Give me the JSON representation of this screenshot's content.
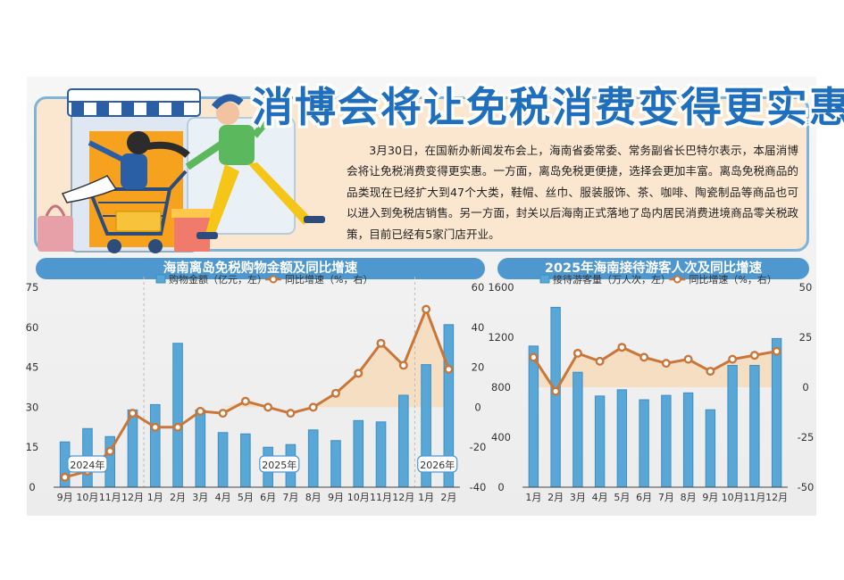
{
  "title": "消博会将让免税消费变得更实惠",
  "intro": "3月30日，在国新办新闻发布会上，海南省委常委、常务副省长巴特尔表示，本届消博会将让免税消费变得更实惠。一方面，离岛免税更便捷，选择会更加丰富。离岛免税商品的品类现在已经扩大到47个大类，鞋帽、丝巾、服装服饰、茶、咖啡、陶瓷制品等商品也可以进入到免税店销售。另一方面，封关以后海南正式落地了岛内居民消费进境商品零关税政策，目前已经有5家门店开业。",
  "colors": {
    "bar": "#58a7d6",
    "line": "#c8763a",
    "accent": "#1f6fbd",
    "header": "#4f97cf"
  },
  "chart_data": [
    {
      "type": "bar",
      "title": "海南离岛免税购物金额及同比增速",
      "categories": [
        "9月",
        "10月",
        "11月",
        "12月",
        "1月",
        "2月",
        "3月",
        "4月",
        "5月",
        "6月",
        "7月",
        "8月",
        "9月",
        "10月",
        "11月",
        "12月",
        "1月",
        "2月"
      ],
      "year_markers": [
        {
          "label": "2024年",
          "index": 1
        },
        {
          "label": "2025年",
          "index": 9.5
        },
        {
          "label": "2026年",
          "index": 16.5
        }
      ],
      "series": [
        {
          "name": "购物金额（亿元，左）",
          "type": "bar",
          "axis": "left",
          "values": [
            17,
            22,
            19,
            29,
            31,
            54,
            29,
            20.5,
            20,
            15,
            16,
            21.5,
            17.5,
            25,
            24.5,
            34.5,
            46,
            61
          ]
        },
        {
          "name": "同比增速（%，右）",
          "type": "line",
          "axis": "right",
          "values": [
            -35,
            -32,
            -22,
            -3,
            -10,
            -10,
            -2,
            -3,
            3,
            0,
            -3,
            0,
            7,
            17,
            32,
            21,
            49,
            19
          ]
        }
      ],
      "ylim_left": [
        0,
        75
      ],
      "yticks_left": [
        0,
        15,
        30,
        45,
        60,
        75
      ],
      "ylim_right": [
        -40,
        60
      ],
      "yticks_right": [
        -40,
        -20,
        0,
        20,
        40,
        60
      ]
    },
    {
      "type": "bar",
      "title": "2025年海南接待游客人次及同比增速",
      "categories": [
        "1月",
        "2月",
        "3月",
        "4月",
        "5月",
        "6月",
        "7月",
        "8月",
        "9月",
        "10月",
        "11月",
        "12月"
      ],
      "series": [
        {
          "name": "接待游客量（万人次，左）",
          "type": "bar",
          "axis": "left",
          "values": [
            1130,
            1440,
            920,
            730,
            780,
            700,
            735,
            755,
            620,
            975,
            975,
            1190
          ]
        },
        {
          "name": "同比增速（%，右）",
          "type": "line",
          "axis": "right",
          "values": [
            15,
            -2,
            17,
            13,
            20,
            15,
            12,
            14,
            8,
            14,
            16,
            18
          ]
        }
      ],
      "ylim_left": [
        0,
        1600
      ],
      "yticks_left": [
        0,
        400,
        800,
        1200,
        1600
      ],
      "ylim_right": [
        -50,
        50
      ],
      "yticks_right": [
        -50,
        -25,
        0,
        25,
        50
      ]
    }
  ]
}
